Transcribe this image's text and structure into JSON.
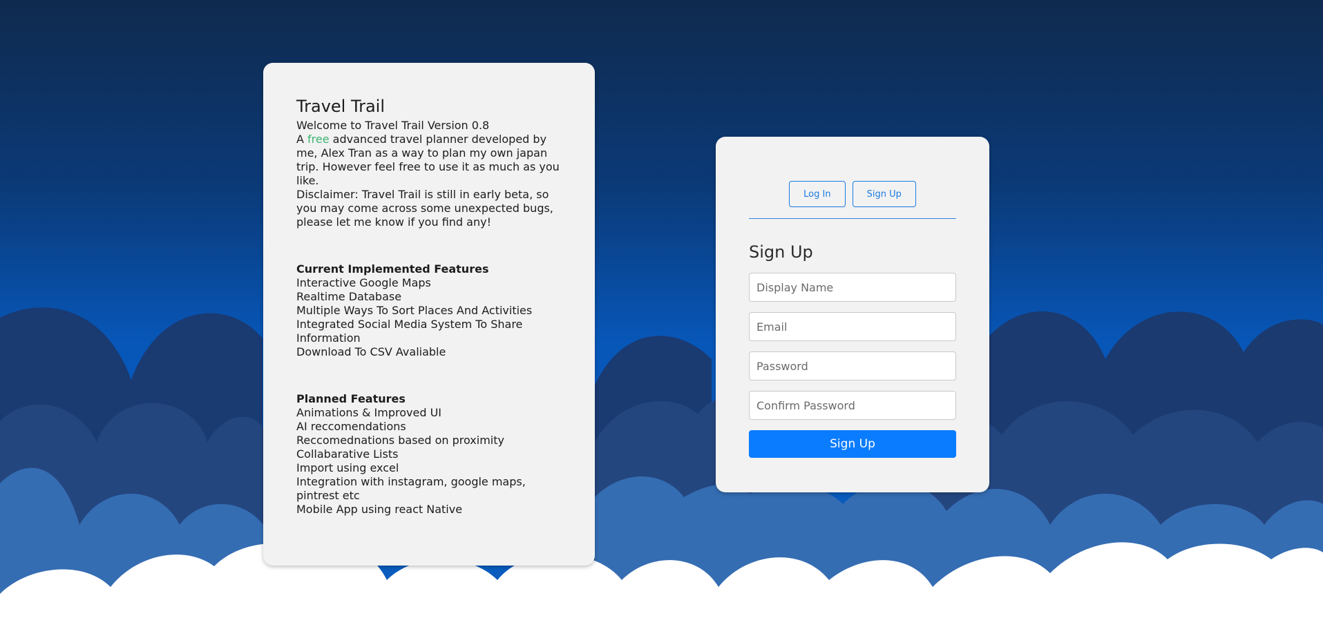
{
  "colors": {
    "accent": "#0a7cff",
    "free_highlight": "#3cb371",
    "card_bg": "#f2f2f2"
  },
  "info": {
    "title": "Travel Trail",
    "welcome": "Welcome to Travel Trail Version 0.8",
    "desc_prefix": "A ",
    "desc_free": "free",
    "desc_rest": " advanced travel planner developed by me, Alex Tran as a way to plan my own japan trip. However feel free to use it as much as you like.",
    "disclaimer": "Disclaimer: Travel Trail is still in early beta, so you may come across some unexpected bugs, please let me know if you find any!",
    "current_heading": "Current Implemented Features",
    "current_features": [
      "Interactive Google Maps",
      "Realtime Database",
      "Multiple Ways To Sort Places And Activities",
      "Integrated Social Media System To Share Information",
      "Download To CSV Avaliable"
    ],
    "planned_heading": "Planned Features",
    "planned_features": [
      "Animations & Improved UI",
      "AI reccomendations",
      "Reccomednations based on proximity",
      "Collabarative Lists",
      "Import using excel",
      "Integration with instagram, google maps, pintrest etc",
      "Mobile App using react Native"
    ]
  },
  "auth": {
    "login_tab": "Log In",
    "signup_tab": "Sign Up",
    "form_title": "Sign Up",
    "display_name_placeholder": "Display Name",
    "email_placeholder": "Email",
    "password_placeholder": "Password",
    "confirm_password_placeholder": "Confirm Password",
    "submit_label": "Sign Up"
  }
}
